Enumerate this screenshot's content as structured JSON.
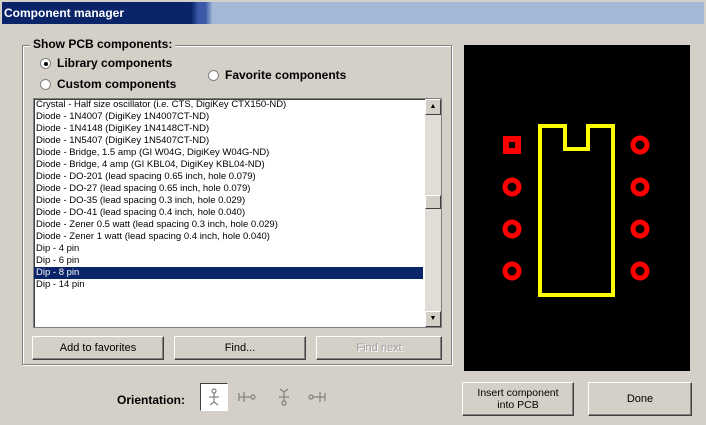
{
  "window": {
    "title": "Component manager"
  },
  "group": {
    "label": "Show PCB components:",
    "radios": [
      {
        "label": "Library components",
        "checked": true
      },
      {
        "label": "Custom components",
        "checked": false
      },
      {
        "label": "Favorite components",
        "checked": false
      }
    ]
  },
  "list": {
    "items": [
      "Crystal - Half size oscillator (i.e. CTS, DigiKey CTX150-ND)",
      "Diode - 1N4007  (DigiKey 1N4007CT-ND)",
      "Diode - 1N4148  (DigiKey 1N4148CT-ND)",
      "Diode - 1N5407  (DigiKey 1N5407CT-ND)",
      "Diode - Bridge, 1.5 amp  (GI W04G, DigiKey W04G-ND)",
      "Diode - Bridge, 4 amp  (GI KBL04, DigiKey KBL04-ND)",
      "Diode - DO-201  (lead spacing 0.65 inch, hole 0.079)",
      "Diode - DO-27  (lead spacing 0.65 inch, hole 0.079)",
      "Diode - DO-35  (lead spacing 0.3 inch, hole 0.029)",
      "Diode - DO-41  (lead spacing 0.4 inch, hole 0.040)",
      "Diode - Zener 0.5 watt  (lead spacing 0.3 inch, hole 0.029)",
      "Diode - Zener 1 watt  (lead spacing 0.4 inch, hole 0.040)",
      "Dip -  4 pin",
      "Dip -  6 pin",
      "Dip -  8 pin",
      "Dip - 14 pin"
    ],
    "selected_index": 14
  },
  "buttons": {
    "add_favorites": "Add to favorites",
    "find": "Find...",
    "find_next": "Find next",
    "insert": "Insert component into PCB",
    "done": "Done"
  },
  "orientation": {
    "label": "Orientation:"
  },
  "colors": {
    "pad": "#ff0000",
    "outline": "#ffff00",
    "background": "#000000"
  },
  "icons": [
    "scroll-up-arrow-icon",
    "scroll-down-arrow-icon",
    "orientation-up-icon",
    "orientation-left-icon",
    "orientation-down-icon",
    "orientation-right-icon"
  ]
}
